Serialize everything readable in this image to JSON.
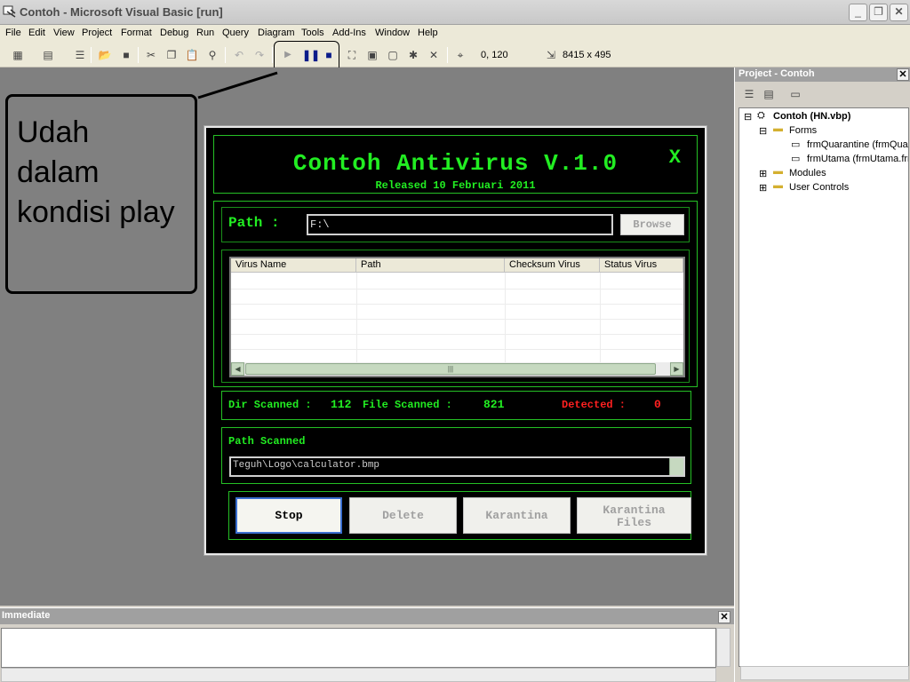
{
  "window": {
    "title": "Contoh - Microsoft Visual Basic [run]"
  },
  "menu": [
    "File",
    "Edit",
    "View",
    "Project",
    "Format",
    "Debug",
    "Run",
    "Query",
    "Diagram",
    "Tools",
    "Add-Ins",
    "Window",
    "Help"
  ],
  "toolbar": {
    "position_readout": "0, 120",
    "size_readout": "8415 x 495"
  },
  "annotation": {
    "text": "Udah\ndalam\nkondisi play"
  },
  "app": {
    "title": "Contoh Antivirus V.1.0",
    "subtitle": "Released 10 Februari 2011",
    "close_label": "X",
    "path_label": "Path :",
    "path_value": "F:\\",
    "browse_label": "Browse",
    "columns": [
      "Virus Name",
      "Path",
      "Checksum Virus",
      "Status Virus"
    ],
    "dir_scanned_label": "Dir Scanned :",
    "dir_scanned_value": "112",
    "file_scanned_label": "File Scanned :",
    "file_scanned_value": "821",
    "detected_label": "Detected :",
    "detected_value": "0",
    "path_scanned_label": "Path Scanned",
    "path_scanned_value": "Teguh\\Logo\\calculator.bmp",
    "buttons": {
      "stop": "Stop",
      "delete": "Delete",
      "karantina": "Karantina",
      "karantina_files": "Karantina Files"
    },
    "colors": {
      "green": "#22ee22",
      "red": "#ff2020"
    }
  },
  "immediate": {
    "title": "Immediate"
  },
  "project": {
    "title": "Project - Contoh",
    "root": "Contoh (HN.vbp)",
    "forms_folder": "Forms",
    "form1": "frmQuarantine (frmQuarantine.frm)",
    "form2": "frmUtama (frmUtama.frm)",
    "modules": "Modules",
    "user_controls": "User Controls"
  }
}
